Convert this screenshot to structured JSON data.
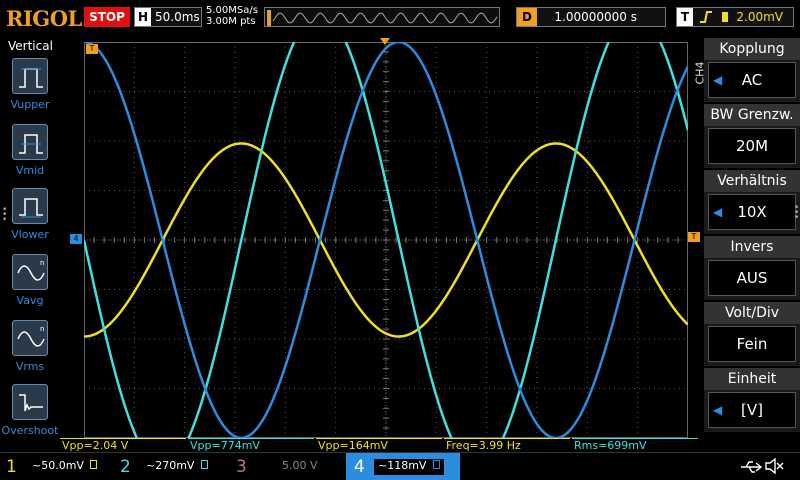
{
  "header": {
    "brand": "RIGOL",
    "run_state": "STOP",
    "timebase_label": "H",
    "timebase_value": "50.0ms",
    "sample_rate": "5.00MSa/s",
    "memory_depth": "3.00M pts",
    "delay_label": "D",
    "delay_value": "1.00000000 s",
    "trigger_label": "T",
    "trigger_level": "2.00mV"
  },
  "left_menu": {
    "title": "Vertical",
    "items": [
      {
        "label": "Vupper",
        "icon": "vupper-icon"
      },
      {
        "label": "Vmid",
        "icon": "vmid-icon"
      },
      {
        "label": "Vlower",
        "icon": "vlower-icon"
      },
      {
        "label": "Vavg",
        "icon": "vavg-icon"
      },
      {
        "label": "Vrms",
        "icon": "vrms-icon"
      },
      {
        "label": "Overshoot",
        "icon": "overshoot-icon"
      }
    ]
  },
  "markers": {
    "trigger_left": "T",
    "channel4_ref": "4",
    "trigger_right": "T"
  },
  "measurements": [
    {
      "text": "Vpp=2.04 V",
      "color": "#f0e020"
    },
    {
      "text": "Vpp=774mV",
      "color": "#40e0e0"
    },
    {
      "text": "Vpp=164mV",
      "color": "#f0e020"
    },
    {
      "text": "Freq=3.99 Hz",
      "color": "#f0e020"
    },
    {
      "text": "Rms=699mV",
      "color": "#40e0e0"
    }
  ],
  "right_menu": {
    "channel": "CH4",
    "groups": [
      {
        "title": "Kopplung",
        "value": "AC"
      },
      {
        "title": "BW Grenzw.",
        "value": "20M"
      },
      {
        "title": "Verhältnis",
        "value": "10X"
      },
      {
        "title": "Invers",
        "value": "AUS"
      },
      {
        "title": "Volt/Div",
        "value": "Fein"
      },
      {
        "title": "Einheit",
        "value": "[V]"
      }
    ]
  },
  "channels": [
    {
      "num": "1",
      "coupling": "~",
      "scale": "50.0mV",
      "color": "#f0e020"
    },
    {
      "num": "2",
      "coupling": "~",
      "scale": "270mV",
      "color": "#40e0e0"
    },
    {
      "num": "3",
      "coupling": "",
      "scale": "5.00 V",
      "color": "#c070a0"
    },
    {
      "num": "4",
      "coupling": "~",
      "scale": "118mV",
      "color": "#2b8de0"
    }
  ],
  "colors": {
    "ch1": "#f0e020",
    "ch2": "#40e0e0",
    "ch3": "#c070a0",
    "ch4": "#2b8de0",
    "trigger": "#f0a020",
    "stop": "#e01010"
  },
  "waveforms": [
    {
      "channel": "1",
      "amplitude_div": 1.95,
      "offset_div": 0,
      "period_div": 6.25,
      "phase_deg": 180
    },
    {
      "channel": "2",
      "amplitude_div": 4.6,
      "offset_div": 0,
      "period_div": 6.25,
      "phase_deg": 90
    },
    {
      "channel": "4",
      "amplitude_div": 4.0,
      "offset_div": 0,
      "period_div": 6.25,
      "phase_deg": 0
    }
  ]
}
